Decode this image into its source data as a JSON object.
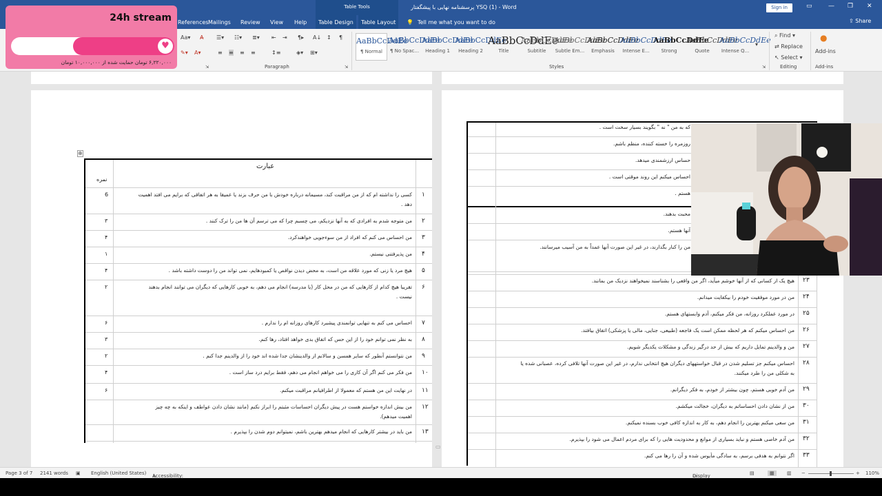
{
  "titlebar": {
    "title": "پرسشنامه نهایی با پیشگفتار YSQ (1) - Word",
    "table_tools": "Table Tools",
    "sign_in": "Sign in"
  },
  "tabs": [
    "References",
    "Mailings",
    "Review",
    "View",
    "Help",
    "Table Design",
    "Table Layout"
  ],
  "tell_me": "Tell me what you want to do",
  "share": "Share",
  "ribbon": {
    "paragraph_label": "Paragraph",
    "styles_label": "Styles",
    "editing_label": "Editing",
    "addins_label": "Add-ins",
    "find": "Find",
    "replace": "Replace",
    "select": "Select",
    "addins_btn": "Add-ins",
    "styles": [
      {
        "preview": "AaBbCcDdEe",
        "label": "¶ Normal"
      },
      {
        "preview": "AaBbCcDdEe",
        "label": "¶ No Spac..."
      },
      {
        "preview": "AaBbCcDdEe",
        "label": "Heading 1"
      },
      {
        "preview": "AaBbCcDdEe",
        "label": "Heading 2"
      },
      {
        "preview": "AaBbCcDdEe",
        "label": "Title"
      },
      {
        "preview": "AaBbCcDdEe",
        "label": "Subtitle"
      },
      {
        "preview": "AaBbCcDdEe",
        "label": "Subtle Em..."
      },
      {
        "preview": "AaBbCcDdEe",
        "label": "Emphasis"
      },
      {
        "preview": "AaBbCcDdEe",
        "label": "Intense E..."
      },
      {
        "preview": "AaBbCcDdEe",
        "label": "Strong"
      },
      {
        "preview": "AaBbCcDdEe",
        "label": "Quote"
      },
      {
        "preview": "AaBbCcDdEe",
        "label": "Intense Q..."
      }
    ]
  },
  "stream": {
    "title": "24h stream",
    "progress_fraction": 0.62,
    "subtitle": "۶,۲۲۰,۰۰۰ تومان حمایت شده از ۱۰,۰۰۰,۰۰۰ تومان"
  },
  "left_table": {
    "header_text": "عبارت",
    "header_score": "نمره",
    "rows": [
      {
        "n": "۱",
        "text": "کسی را نداشته ام که از من مراقبت کند، مسیمانه درباره خودش با من حرف بزند یا عمیقا به هر اتفاقی که برایم می افتد اهمیت",
        "text2": "دهد .",
        "score": "6"
      },
      {
        "n": "۲",
        "text": "من متوجه شدم به افرادی که به آنها نزدیکم، می چسبم چرا که می ترسم آن ها من را ترک کنند .",
        "score": "۳"
      },
      {
        "n": "۳",
        "text": "من احساس می کنم که افراد از من سوءجویی خواهندکرد.",
        "score": "۴"
      },
      {
        "n": "۴",
        "text": "من پذیرفتنی نیستم.",
        "score": "۱"
      },
      {
        "n": "۵",
        "text": "هیچ مرد یا زنی که مورد علاقه من است، به محض دیدن نواقص یا کمبودهایم، نمی تواند من را دوست داشته باشد .",
        "score": "۴"
      },
      {
        "n": "۶",
        "text": "تقریبا هیچ کدام از کارهایی که من در محل کار (یا مدرسه) انجام می دهم، به خوبی کارهایی که دیگران می توانند انجام بدهند",
        "text2": "نیست .",
        "score": "۲"
      },
      {
        "n": "۷",
        "text": "احساس می کنم به تنهایی توانمندی پیشبرد کارهای روزانه ام را ندارم .",
        "score": "۶"
      },
      {
        "n": "۸",
        "text": "به نظر نمی توانم خود را از این حس که اتفاق بدی خواهد افتاد، رها کنم.",
        "score": "۳"
      },
      {
        "n": "۹",
        "text": "من نتوانستم آنطور که سایر همسن و سالانم از والدینشان جدا شده اند خود را از والدینم جدا کنم .",
        "score": "۲"
      },
      {
        "n": "۱۰",
        "text": "من فکر می کنم اگر آن کاری را می خواهم انجام می دهم، فقط برایم درد ساز است .",
        "score": "۴"
      },
      {
        "n": "۱۱",
        "text": "در نهایت این من هستم که معمولا از اطرافیانم مراقبت میکنم.",
        "score": "۶"
      },
      {
        "n": "۱۲",
        "text": "من بیش اندازه خواستم هست در پیش دیگران احساسات مثبتم را ابراز نکنم (مانند نشان دادن عواطف و اینکه به چه چیز",
        "text2": "اهمیت میدهم).",
        "score": ""
      },
      {
        "n": "۱۳",
        "text": "من باید در بیشتر کارهایی که انجام میدهم بهترین باشم، نمیتوانم دوم شدن را بپذیرم .",
        "score": ""
      }
    ]
  },
  "right_table": {
    "top_rows": [
      "که به من \" نه \" بگویند بسیار سخت است .",
      "روزمره را خسته کننده، منظم باشم.",
      "حساس ارزشمندی میدهد.",
      "احساس میکنم این روند موقتی است .",
      "هستم ."
    ],
    "mid_rows": [
      "محبت بدهند.",
      "آنها هستم.",
      "من را کنار بگذارند، در غیر این صورت آنها عمداً به من آسیب میرسانند."
    ],
    "rows": [
      {
        "n": "۲۳",
        "text": "هیچ یک از کسانی که از آنها خوشم میآید، اگر من واقعی را بشناسند نمیخواهند نزدیک من بمانند."
      },
      {
        "n": "۲۴",
        "text": "من در مورد موفقیت خودم را بیکفایت میدانم."
      },
      {
        "n": "۲۵",
        "text": "در مورد عملکرد روزانه، من فکر میکنم، آدم وابستهای هستم."
      },
      {
        "n": "۲۶",
        "text": "من احساس میکنم که هر لحظه ممکن است یک فاجعه (طبیعی، جنایی، مالی یا پزشکی) اتفاق بیافتد."
      },
      {
        "n": "۲۷",
        "text": "من و والدینم تمایل داریم که بیش از حد درگیر زندگی و مشکلات یکدیگر شویم."
      },
      {
        "n": "۲۸",
        "text": "احساس میکنم جز تسلیم شدن در قبال خواستههای دیگران هیچ انتخابی ندارم، در غیر این صورت آنها تلافی کرده، عصبانی شده یا",
        "text2": "به شکلی من را طرد میکنند."
      },
      {
        "n": "۲۹",
        "text": "من آدم خوبی هستم، چون بیشتر از خودم، به فکر دیگرانم."
      },
      {
        "n": "۳۰",
        "text": "من از نشان دادن احساساتم به دیگران، خجالت میکشم."
      },
      {
        "n": "۳۱",
        "text": "من سعی میکنم بهترین را انجام دهم، به کار به اندازه کافی خوب بسنده نمیکنم."
      },
      {
        "n": "۳۲",
        "text": "من آدم خاصی هستم و نباید بسیاری از موانع و محدودیت هایی را که برای مردم اعمال می شود را بپذیرم."
      },
      {
        "n": "۳۳",
        "text": "اگر نتوانم به هدفی برسم، به سادگی مأیوس شده و آن را رها می کنم."
      }
    ]
  },
  "statusbar": {
    "page": "Page 3 of 7",
    "words": "2141 words",
    "language": "English (United States)",
    "accessibility": "Accessibility: Unavailable",
    "display_settings": "Display Settings",
    "zoom": "110%"
  }
}
